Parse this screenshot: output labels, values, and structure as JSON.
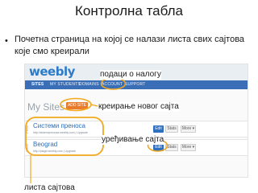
{
  "slide": {
    "title": "Контролна табла",
    "bullet": "Почетна страница на којој се налази листа свих сајтова које смо креирали"
  },
  "screenshot": {
    "logo": "weebly",
    "nav": {
      "sites": "SITES",
      "students": "MY STUDENTS",
      "domains": "DOMAINS",
      "account": "ACCOUNT",
      "support": "SUPPORT"
    },
    "heading": "My Sites",
    "add_site_label": "ADD SITE",
    "free_tag": "FREE",
    "sites": [
      {
        "name": "Системи преноса",
        "url": "http://sistemiprenosa.weebly.com  |  Upgrade",
        "edit": "Edit",
        "stats": "Stats",
        "more": "More ▾"
      },
      {
        "name": "Beograd",
        "url": "http://ptagb.weebly.com  |  Upgrade",
        "edit": "Edit",
        "stats": "Stats",
        "more": "More ▾"
      }
    ]
  },
  "annotations": {
    "account": "подаци о налогу",
    "new_site": "креирање новог сајта",
    "edit_site": "уређивање сајта",
    "site_list": "листа сајтова"
  },
  "colors": {
    "highlight": "#f2a81d",
    "brand": "#2d7ac6",
    "nav_bar": "#3a6fb7",
    "add_button": "#e87b2c"
  }
}
